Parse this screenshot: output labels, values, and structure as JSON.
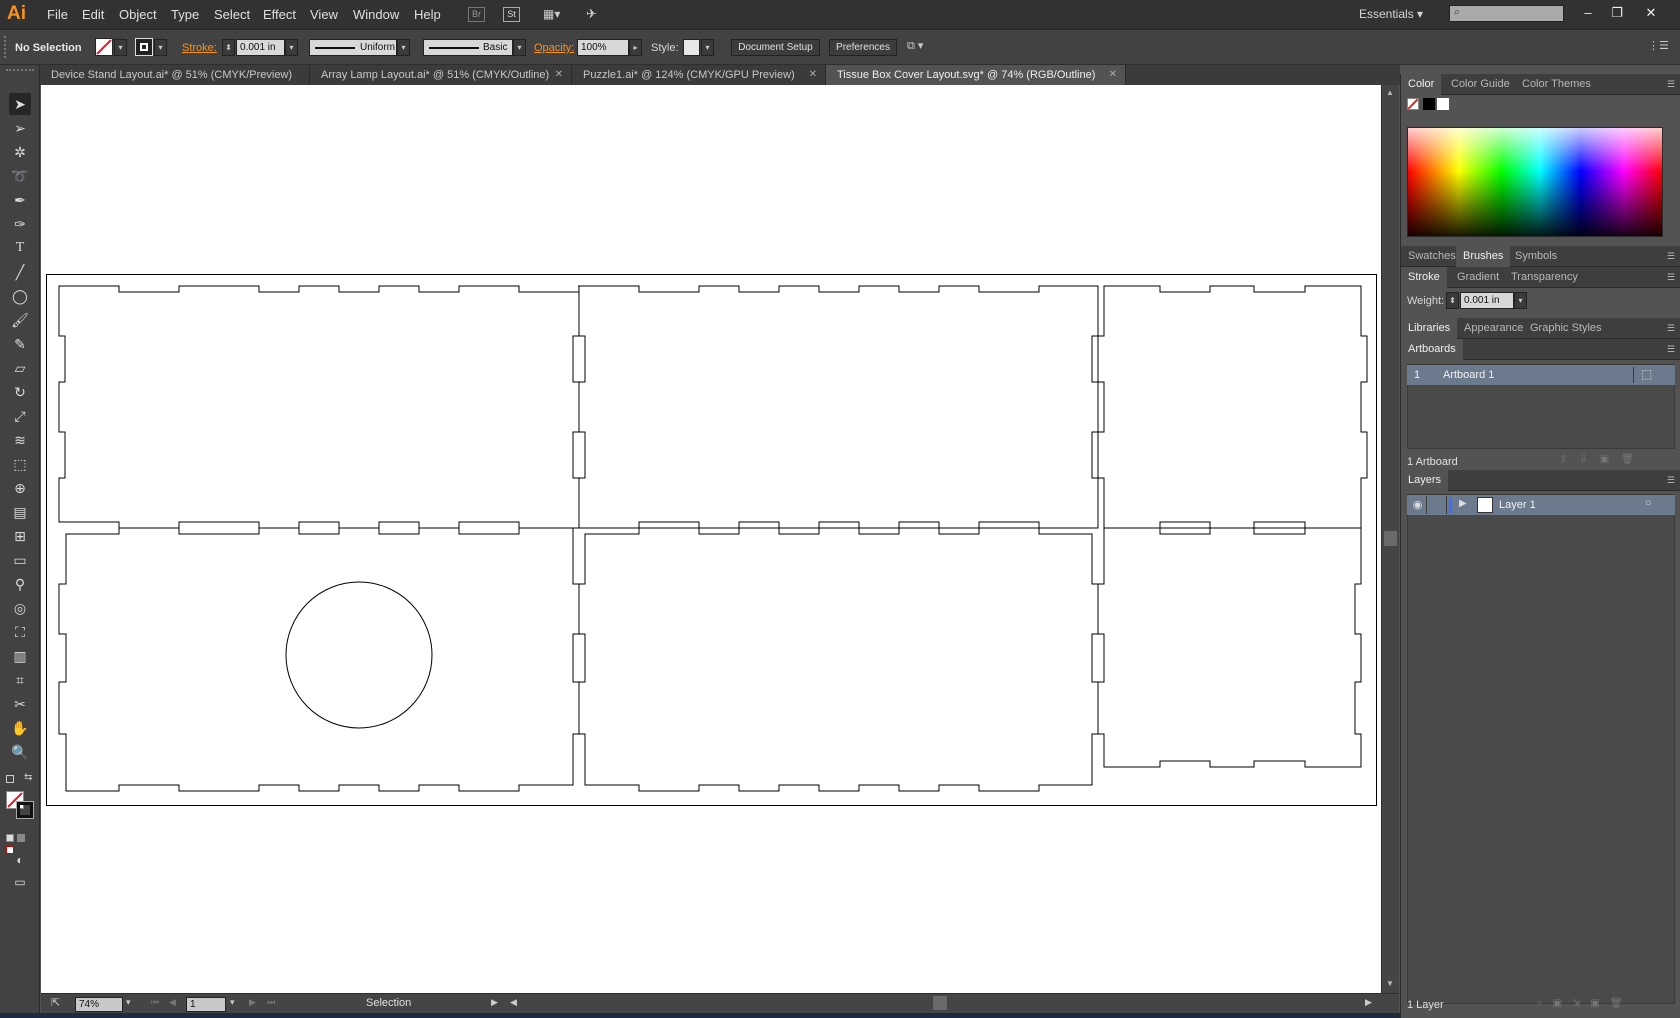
{
  "app": {
    "logo": "Ai",
    "menu": [
      "File",
      "Edit",
      "Object",
      "Type",
      "Select",
      "Effect",
      "View",
      "Window",
      "Help"
    ],
    "bridge_label": "Br",
    "stock_label": "St",
    "workspace": "Essentials ▾",
    "window_controls": [
      "‒",
      "❐",
      "✕"
    ]
  },
  "control": {
    "selection": "No Selection",
    "stroke_label": "Stroke:",
    "stroke_value": "0.001 in",
    "profile": "Uniform",
    "brush": "Basic",
    "opacity_label": "Opacity:",
    "opacity_value": "100%",
    "style_label": "Style:",
    "doc_setup": "Document Setup",
    "preferences": "Preferences"
  },
  "tabs": [
    {
      "label": "Device Stand Layout.ai* @ 51% (CMYK/Preview)"
    },
    {
      "label": "Array Lamp Layout.ai* @ 51% (CMYK/Outline)"
    },
    {
      "label": "Puzzle1.ai* @ 124% (CMYK/GPU Preview)"
    },
    {
      "label": "Tissue Box Cover Layout.svg* @ 74% (RGB/Outline)",
      "active": true
    }
  ],
  "status": {
    "zoom": "74%",
    "artboard_num": "1",
    "tool_name": "Selection"
  },
  "panels": {
    "color_tabs": [
      "Color",
      "Color Guide",
      "Color Themes"
    ],
    "brush_tabs": [
      "Swatches",
      "Brushes",
      "Symbols"
    ],
    "stroke_tabs": [
      "Stroke",
      "Gradient",
      "Transparency"
    ],
    "weight_label": "Weight:",
    "weight_value": "0.001 in",
    "lib_tabs": [
      "Libraries",
      "Appearance",
      "Graphic Styles"
    ],
    "artboards_title": "Artboards",
    "artboard_row_num": "1",
    "artboard_row_name": "Artboard 1",
    "artboard_count": "1 Artboard",
    "layers_title": "Layers",
    "layer_name": "Layer 1",
    "layer_count": "1 Layer"
  },
  "colors": {
    "accent": "#f7931e",
    "panel": "#535353",
    "canvas": "#ffffff"
  }
}
